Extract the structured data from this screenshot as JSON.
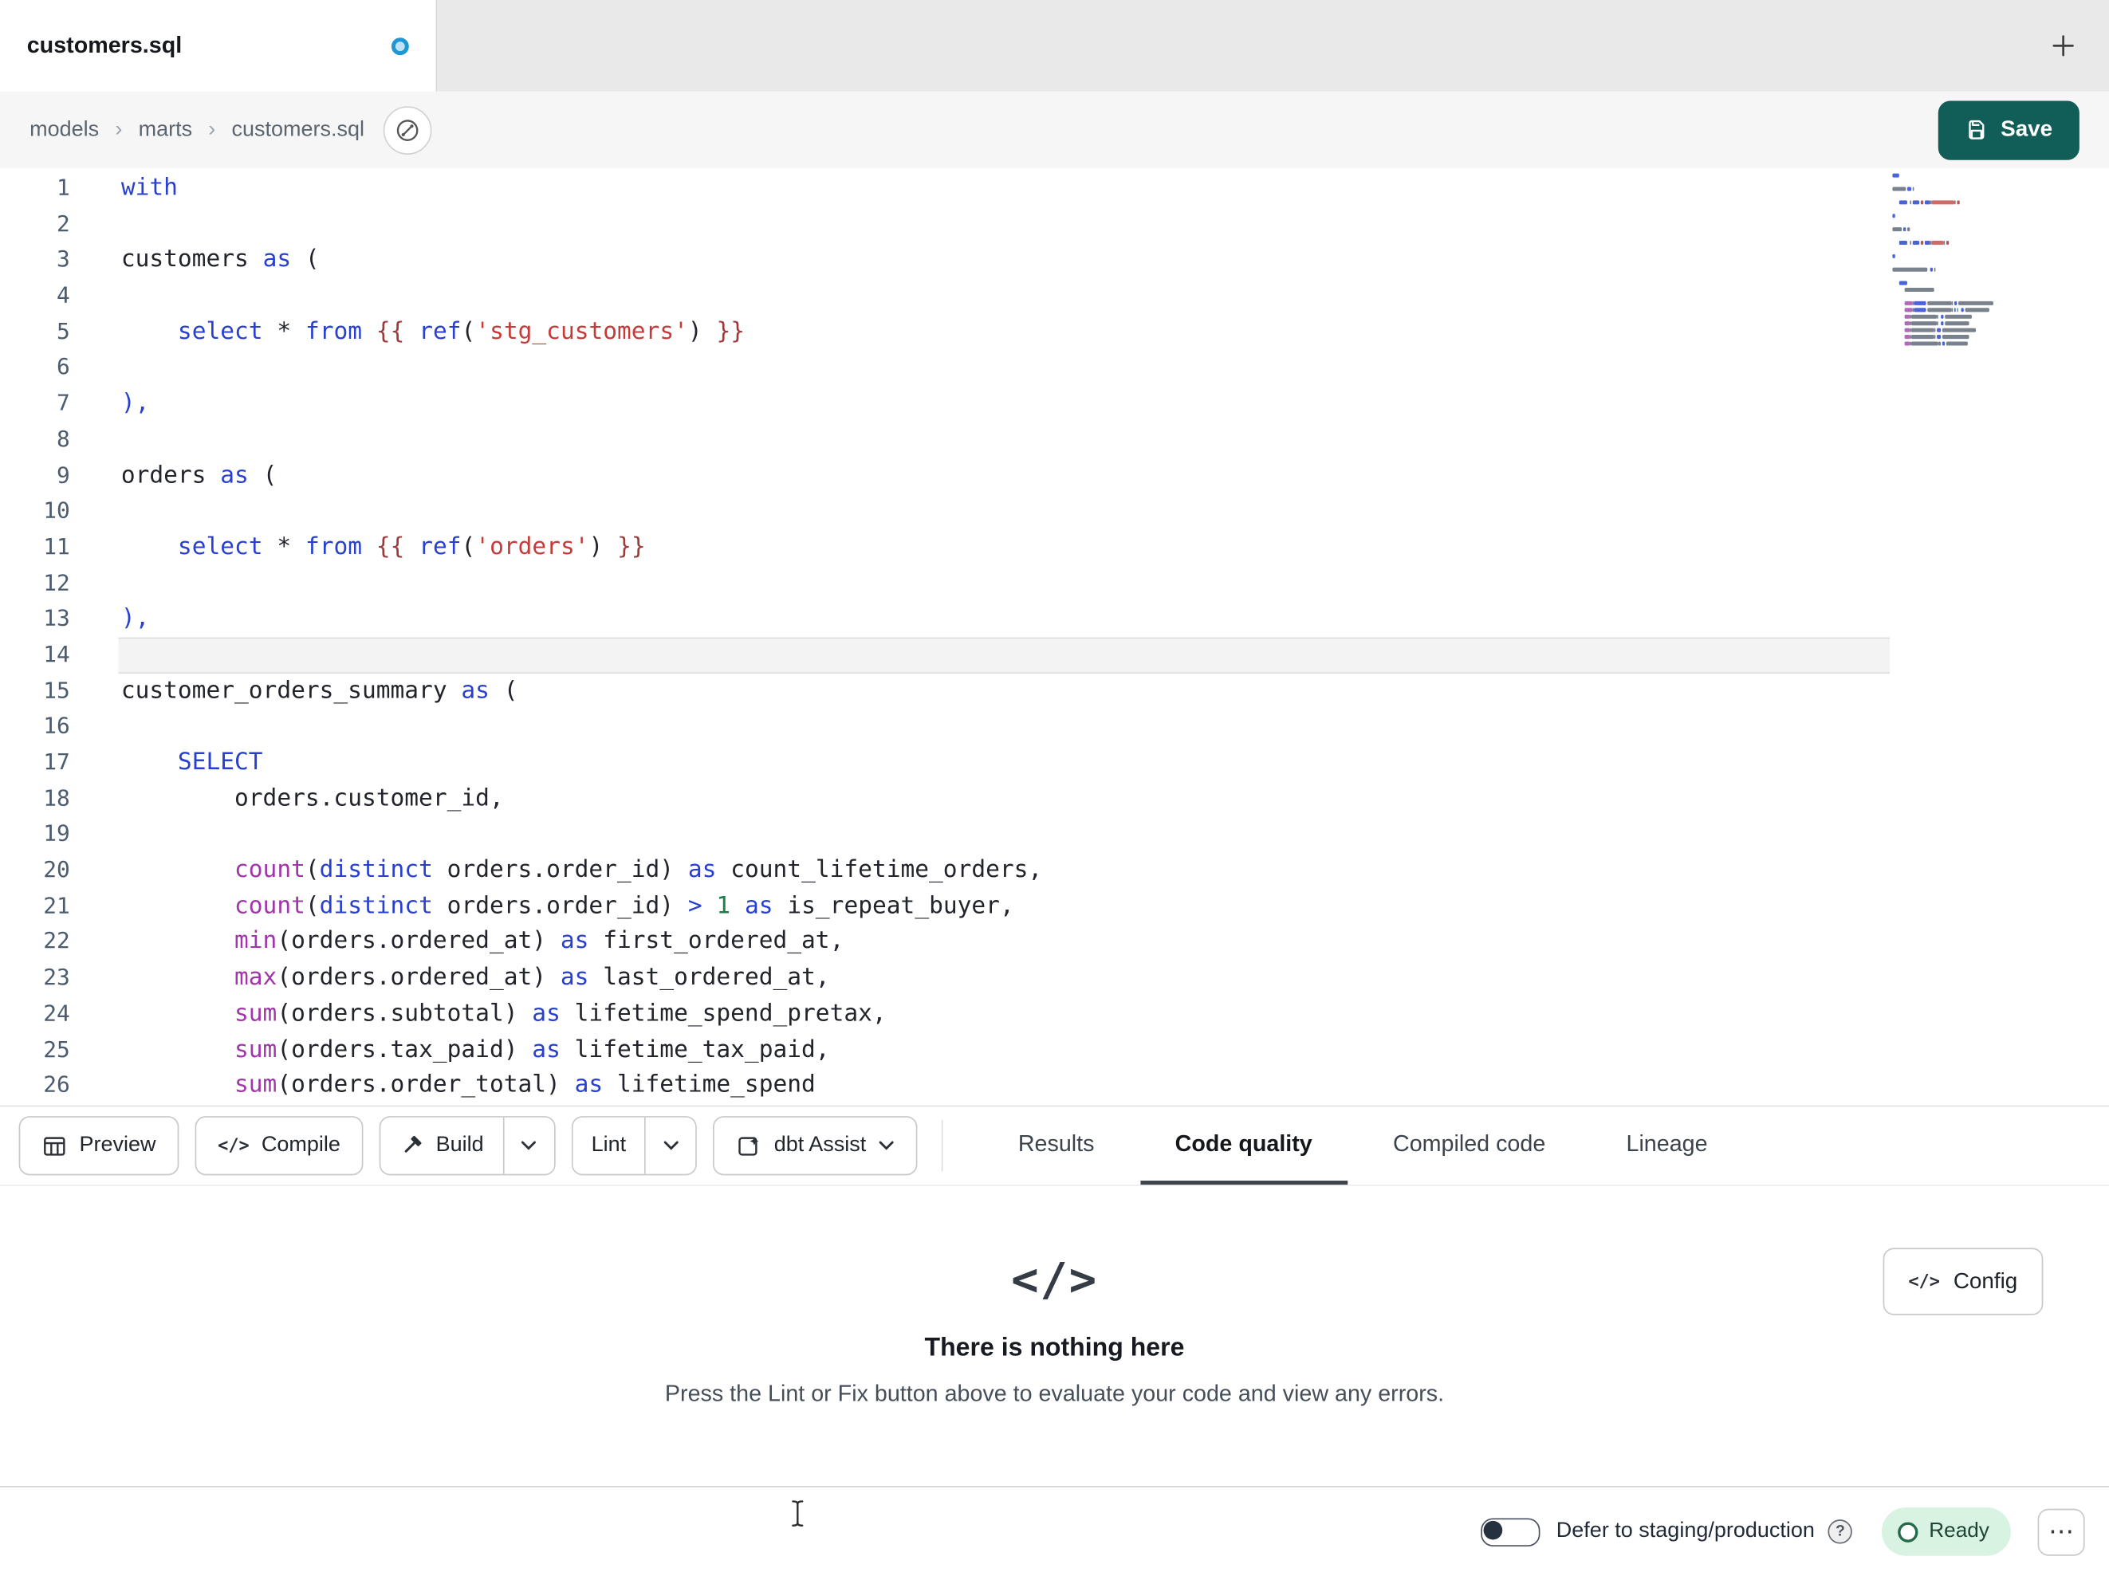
{
  "tab_bar": {
    "tab_title": "customers.sql"
  },
  "breadcrumb": {
    "items": [
      "models",
      "marts",
      "customers.sql"
    ],
    "separator": "›"
  },
  "save_button": {
    "label": "Save"
  },
  "editor": {
    "active_line": 14,
    "lines": [
      [
        [
          "kw",
          "with"
        ]
      ],
      [],
      [
        [
          "id",
          "customers"
        ],
        [
          "ws",
          " "
        ],
        [
          "kw",
          "as"
        ],
        [
          "ws",
          " "
        ],
        [
          "pn",
          "("
        ]
      ],
      [],
      [
        [
          "ws",
          "    "
        ],
        [
          "kw",
          "select"
        ],
        [
          "ws",
          " "
        ],
        [
          "op",
          "*"
        ],
        [
          "ws",
          " "
        ],
        [
          "kw",
          "from"
        ],
        [
          "ws",
          " "
        ],
        [
          "jj",
          "{{"
        ],
        [
          "ws",
          " "
        ],
        [
          "kw",
          "ref"
        ],
        [
          "pn",
          "("
        ],
        [
          "str",
          "'stg_customers'"
        ],
        [
          "pn",
          ")"
        ],
        [
          "ws",
          " "
        ],
        [
          "jj",
          "}}"
        ]
      ],
      [],
      [
        [
          "pn2",
          "),"
        ]
      ],
      [],
      [
        [
          "id",
          "orders"
        ],
        [
          "ws",
          " "
        ],
        [
          "kw",
          "as"
        ],
        [
          "ws",
          " "
        ],
        [
          "pn",
          "("
        ]
      ],
      [],
      [
        [
          "ws",
          "    "
        ],
        [
          "kw",
          "select"
        ],
        [
          "ws",
          " "
        ],
        [
          "op",
          "*"
        ],
        [
          "ws",
          " "
        ],
        [
          "kw",
          "from"
        ],
        [
          "ws",
          " "
        ],
        [
          "jj",
          "{{"
        ],
        [
          "ws",
          " "
        ],
        [
          "kw",
          "ref"
        ],
        [
          "pn",
          "("
        ],
        [
          "str",
          "'orders'"
        ],
        [
          "pn",
          ")"
        ],
        [
          "ws",
          " "
        ],
        [
          "jj",
          "}}"
        ]
      ],
      [],
      [
        [
          "pn2",
          "),"
        ]
      ],
      [],
      [
        [
          "id",
          "customer_orders_summary"
        ],
        [
          "ws",
          " "
        ],
        [
          "kw",
          "as"
        ],
        [
          "ws",
          " "
        ],
        [
          "pn",
          "("
        ]
      ],
      [],
      [
        [
          "ws",
          "    "
        ],
        [
          "kw",
          "SELECT"
        ]
      ],
      [
        [
          "ws",
          "        "
        ],
        [
          "id",
          "orders.customer_id,"
        ]
      ],
      [],
      [
        [
          "ws",
          "        "
        ],
        [
          "fn",
          "count"
        ],
        [
          "pn",
          "("
        ],
        [
          "kw",
          "distinct"
        ],
        [
          "ws",
          " "
        ],
        [
          "id",
          "orders.order_id"
        ],
        [
          "pn",
          ")"
        ],
        [
          "ws",
          " "
        ],
        [
          "kw",
          "as"
        ],
        [
          "ws",
          " "
        ],
        [
          "id",
          "count_lifetime_orders,"
        ]
      ],
      [
        [
          "ws",
          "        "
        ],
        [
          "fn",
          "count"
        ],
        [
          "pn",
          "("
        ],
        [
          "kw",
          "distinct"
        ],
        [
          "ws",
          " "
        ],
        [
          "id",
          "orders.order_id"
        ],
        [
          "pn",
          ")"
        ],
        [
          "ws",
          " "
        ],
        [
          "kw",
          ">"
        ],
        [
          "ws",
          " "
        ],
        [
          "num",
          "1"
        ],
        [
          "ws",
          " "
        ],
        [
          "kw",
          "as"
        ],
        [
          "ws",
          " "
        ],
        [
          "id",
          "is_repeat_buyer,"
        ]
      ],
      [
        [
          "ws",
          "        "
        ],
        [
          "fn",
          "min"
        ],
        [
          "pn",
          "("
        ],
        [
          "id",
          "orders.ordered_at"
        ],
        [
          "pn",
          ")"
        ],
        [
          "ws",
          " "
        ],
        [
          "kw",
          "as"
        ],
        [
          "ws",
          " "
        ],
        [
          "id",
          "first_ordered_at,"
        ]
      ],
      [
        [
          "ws",
          "        "
        ],
        [
          "fn",
          "max"
        ],
        [
          "pn",
          "("
        ],
        [
          "id",
          "orders.ordered_at"
        ],
        [
          "pn",
          ")"
        ],
        [
          "ws",
          " "
        ],
        [
          "kw",
          "as"
        ],
        [
          "ws",
          " "
        ],
        [
          "id",
          "last_ordered_at,"
        ]
      ],
      [
        [
          "ws",
          "        "
        ],
        [
          "fn",
          "sum"
        ],
        [
          "pn",
          "("
        ],
        [
          "id",
          "orders.subtotal"
        ],
        [
          "pn",
          ")"
        ],
        [
          "ws",
          " "
        ],
        [
          "kw",
          "as"
        ],
        [
          "ws",
          " "
        ],
        [
          "id",
          "lifetime_spend_pretax,"
        ]
      ],
      [
        [
          "ws",
          "        "
        ],
        [
          "fn",
          "sum"
        ],
        [
          "pn",
          "("
        ],
        [
          "id",
          "orders.tax_paid"
        ],
        [
          "pn",
          ")"
        ],
        [
          "ws",
          " "
        ],
        [
          "kw",
          "as"
        ],
        [
          "ws",
          " "
        ],
        [
          "id",
          "lifetime_tax_paid,"
        ]
      ],
      [
        [
          "ws",
          "        "
        ],
        [
          "fn",
          "sum"
        ],
        [
          "pn",
          "("
        ],
        [
          "id",
          "orders.order_total"
        ],
        [
          "pn",
          ")"
        ],
        [
          "ws",
          " "
        ],
        [
          "kw",
          "as"
        ],
        [
          "ws",
          " "
        ],
        [
          "id",
          "lifetime_spend"
        ]
      ]
    ]
  },
  "toolbar": {
    "preview_label": "Preview",
    "compile_label": "Compile",
    "build_label": "Build",
    "lint_label": "Lint",
    "assist_label": "dbt Assist",
    "tabs": [
      {
        "label": "Results"
      },
      {
        "label": "Code quality",
        "active": true
      },
      {
        "label": "Compiled code"
      },
      {
        "label": "Lineage"
      }
    ]
  },
  "results_panel": {
    "empty_icon_glyph": "</>",
    "title": "There is nothing here",
    "subtitle": "Press the Lint or Fix button above to evaluate your code and view any errors.",
    "config_label": "Config",
    "config_icon_glyph": "</>"
  },
  "status_bar": {
    "defer_label": "Defer to staging/production",
    "help_glyph": "?",
    "ready_label": "Ready",
    "menu_glyph": "⋯"
  },
  "icons": {
    "compile_glyph": "</>"
  },
  "colors": {
    "save_button_teal": "#115e59",
    "ready_pill_bg": "#d8f3e1",
    "ready_pill_text": "#1e4435",
    "modified_dot_blue": "#1f97d4",
    "keyword_blue": "#2940cf",
    "string_red": "#c43b39",
    "jinja_maroon": "#9e3a3a",
    "function_purple": "#a136ab",
    "number_green": "#1d8043",
    "active_tab_underline": "#3d434b"
  }
}
